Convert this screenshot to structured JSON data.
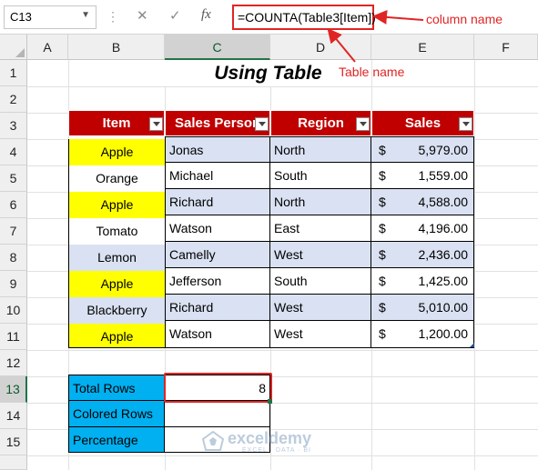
{
  "formula_bar": {
    "name_box": "C13",
    "formula": "=COUNTA(Table3[Item])"
  },
  "annotations": {
    "column_name": "column name",
    "table_name": "Table name"
  },
  "columns": [
    "A",
    "B",
    "C",
    "D",
    "E",
    "F"
  ],
  "rows": [
    "1",
    "2",
    "3",
    "4",
    "5",
    "6",
    "7",
    "8",
    "9",
    "10",
    "11",
    "12",
    "13",
    "14",
    "15"
  ],
  "title": "Using Table",
  "table": {
    "headers": [
      "Item",
      "Sales Person",
      "Region",
      "Sales"
    ],
    "rows": [
      {
        "item": "Apple",
        "person": "Jonas",
        "region": "North",
        "currency": "$",
        "sales": "5,979.00"
      },
      {
        "item": "Orange",
        "person": "Michael",
        "region": "South",
        "currency": "$",
        "sales": "1,559.00"
      },
      {
        "item": "Apple",
        "person": "Richard",
        "region": "North",
        "currency": "$",
        "sales": "4,588.00"
      },
      {
        "item": "Tomato",
        "person": "Watson",
        "region": "East",
        "currency": "$",
        "sales": "4,196.00"
      },
      {
        "item": "Lemon",
        "person": "Camelly",
        "region": "West",
        "currency": "$",
        "sales": "2,436.00"
      },
      {
        "item": "Apple",
        "person": "Jefferson",
        "region": "South",
        "currency": "$",
        "sales": "1,425.00"
      },
      {
        "item": "Blackberry",
        "person": "Richard",
        "region": "West",
        "currency": "$",
        "sales": "5,010.00"
      },
      {
        "item": "Apple",
        "person": "Watson",
        "region": "West",
        "currency": "$",
        "sales": "1,200.00"
      }
    ]
  },
  "summary": {
    "labels": [
      "Total Rows",
      "Colored Rows",
      "Percentage"
    ],
    "total_rows_value": "8"
  },
  "watermark": {
    "brand": "exceldemy",
    "tagline": "EXCEL · DATA · BI"
  },
  "colors": {
    "header_red": "#c00000",
    "highlight_yellow": "#ffff00",
    "band_blue": "#d9e1f2",
    "summary_blue": "#00b0f0",
    "annotation_red": "#e02424"
  }
}
